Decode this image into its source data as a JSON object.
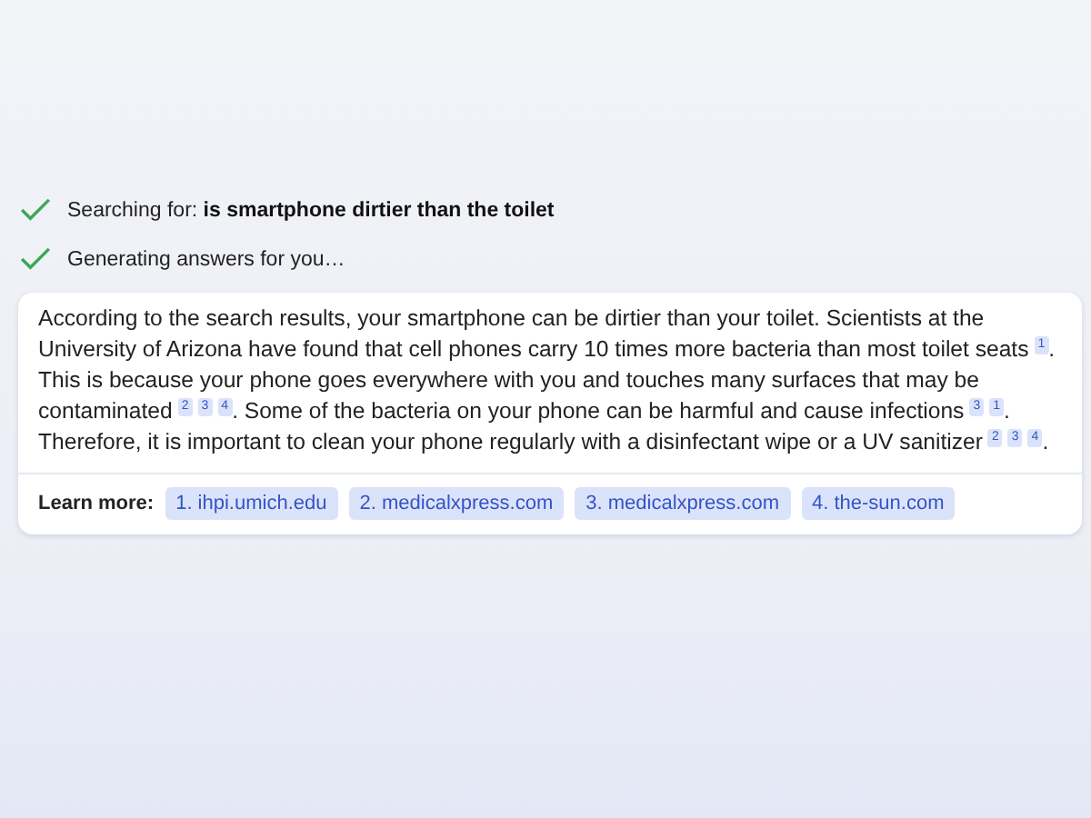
{
  "steps": [
    {
      "text": "Searching for: **is smartphone dirtier than the toilet**",
      "done": true
    },
    {
      "text": "Generating answers for you…",
      "done": true
    }
  ],
  "answer": [
    {
      "text": "According to the search results, your smartphone can be dirtier than your toilet. Scientists at the University of Arizona have found that cell phones carry 10 times more bacteria than most toilet seats",
      "citations": [
        "1"
      ]
    },
    {
      "text": ". This is because your phone goes everywhere with you and touches many surfaces that may be contaminated",
      "citations": [
        "2",
        "3",
        "4"
      ]
    },
    {
      "text": ". Some of the bacteria on your phone can be harmful and cause infections",
      "citations": [
        "3",
        "1"
      ]
    },
    {
      "text": ". Therefore, it is important to clean your phone regularly with a disinfectant wipe or a UV sanitizer",
      "citations": [
        "2",
        "3",
        "4"
      ]
    },
    {
      "text": "."
    }
  ],
  "learn_more": {
    "label": "Learn more:",
    "links": [
      "1. ihpi.umich.edu",
      "2. medicalxpress.com",
      "3. medicalxpress.com",
      "4. the-sun.com"
    ]
  }
}
